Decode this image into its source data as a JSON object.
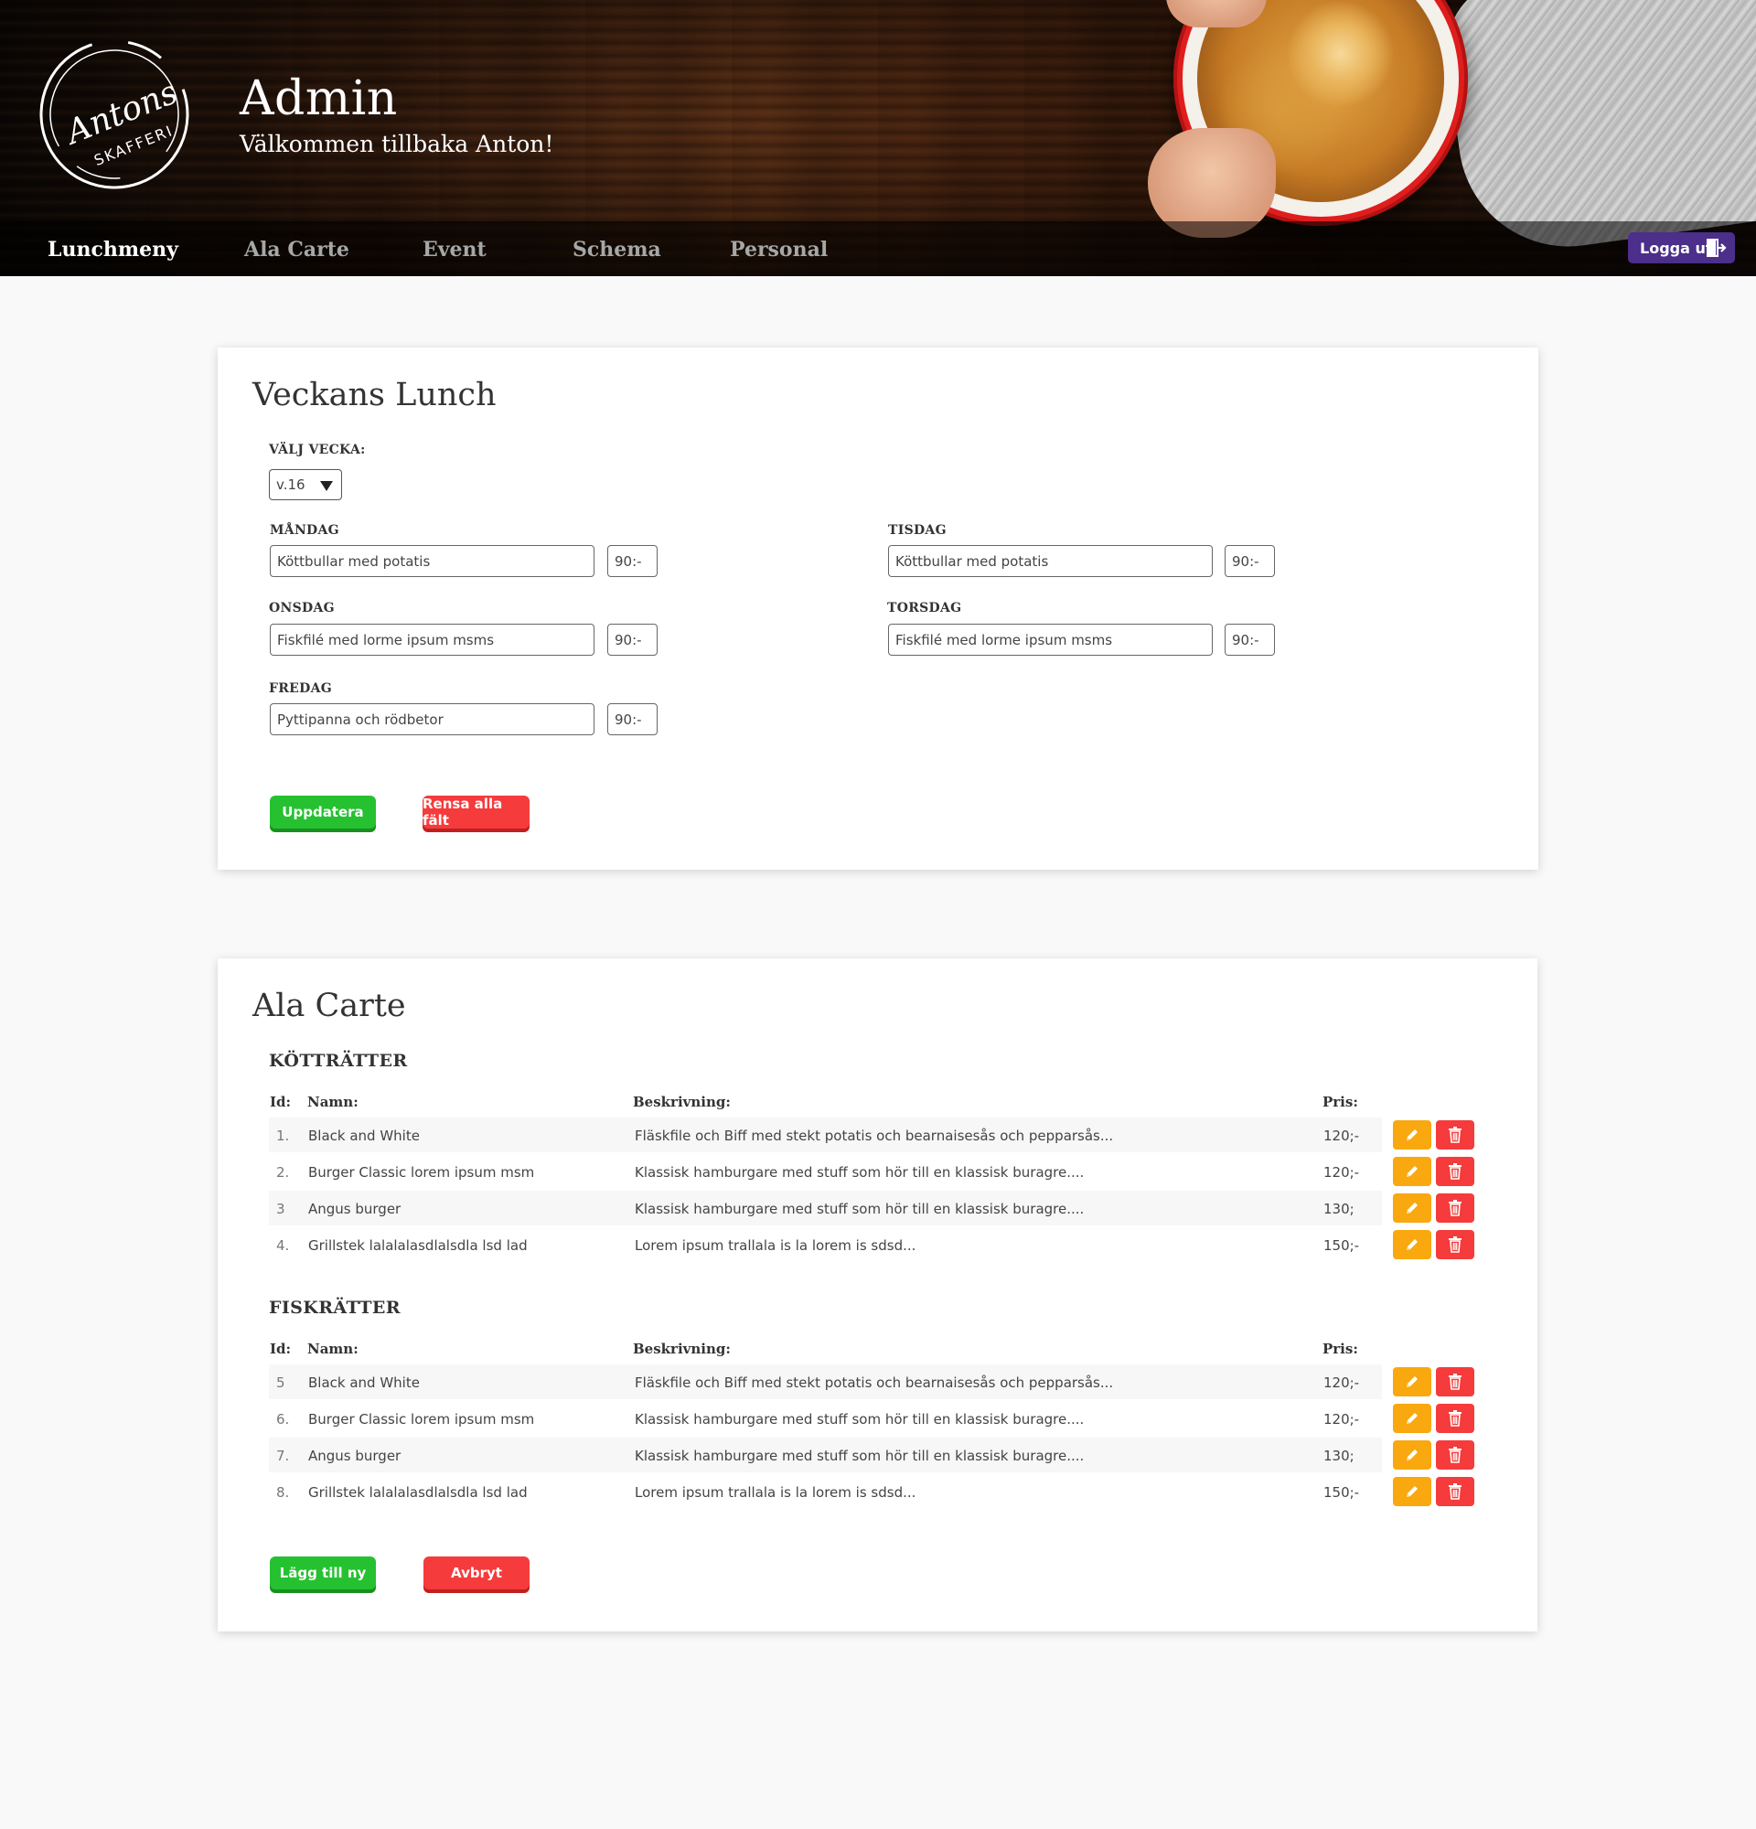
{
  "header": {
    "logo_text_script": "Antons",
    "logo_text_caps": "SKAFFERI",
    "title": "Admin",
    "welcome": "Välkommen tillbaka Anton!"
  },
  "nav": {
    "items": [
      {
        "label": "Lunchmeny",
        "active": true
      },
      {
        "label": "Ala Carte",
        "active": false
      },
      {
        "label": "Event",
        "active": false
      },
      {
        "label": "Schema",
        "active": false
      },
      {
        "label": "Personal",
        "active": false
      }
    ],
    "logout_label": "Logga ut"
  },
  "lunch": {
    "title": "Veckans Lunch",
    "week_label": "VÄLJ VECKA:",
    "week_value": "v.16",
    "days": [
      {
        "label": "MÅNDAG",
        "dish": "Köttbullar med potatis",
        "price": "90:-"
      },
      {
        "label": "TISDAG",
        "dish": "Köttbullar med potatis",
        "price": "90:-"
      },
      {
        "label": "ONSDAG",
        "dish": "Fiskfilé med lorme ipsum msms",
        "price": "90:-"
      },
      {
        "label": "TORSDAG",
        "dish": "Fiskfilé med lorme ipsum msms",
        "price": "90:-"
      },
      {
        "label": "FREDAG",
        "dish": "Pyttipanna och rödbetor",
        "price": "90:-"
      }
    ],
    "update_label": "Uppdatera",
    "clear_label": "Rensa alla fält"
  },
  "alacarte": {
    "title": "Ala Carte",
    "headers": {
      "id": "Id:",
      "name": "Namn:",
      "description": "Beskrivning:",
      "price": "Pris:"
    },
    "sections": [
      {
        "title": "KÖTTRÄTTER",
        "rows": [
          {
            "id": "1.",
            "name": "Black and White",
            "description": "Fläskfile och Biff med stekt potatis och bearnaisesås och pepparsås...",
            "price": "120;-"
          },
          {
            "id": "2.",
            "name": "Burger Classic lorem ipsum msm",
            "description": "Klassisk hamburgare med stuff som hör till en klassisk buragre....",
            "price": "120;-"
          },
          {
            "id": "3",
            "name": "Angus burger",
            "description": "Klassisk hamburgare med stuff som hör till en klassisk buragre....",
            "price": "130;"
          },
          {
            "id": "4.",
            "name": "Grillstek lalalalasdlalsdla lsd lad",
            "description": "Lorem ipsum trallala is la lorem is sdsd...",
            "price": "150;-"
          }
        ]
      },
      {
        "title": "FISKRÄTTER",
        "rows": [
          {
            "id": "5",
            "name": "Black and White",
            "description": "Fläskfile och Biff med stekt potatis och bearnaisesås och pepparsås...",
            "price": "120;-"
          },
          {
            "id": "6.",
            "name": "Burger Classic lorem ipsum msm",
            "description": "Klassisk hamburgare med stuff som hör till en klassisk buragre....",
            "price": "120;-"
          },
          {
            "id": "7.",
            "name": "Angus burger",
            "description": "Klassisk hamburgare med stuff som hör till en klassisk buragre....",
            "price": "130;"
          },
          {
            "id": "8.",
            "name": "Grillstek lalalalasdlalsdla lsd lad",
            "description": "Lorem ipsum trallala is la lorem is sdsd...",
            "price": "150;-"
          }
        ]
      }
    ],
    "add_label": "Lägg till ny",
    "cancel_label": "Avbryt"
  },
  "colors": {
    "green": "#26c131",
    "red": "#f53b3b",
    "orange": "#f9a80f",
    "purple": "#4b2f8a"
  },
  "icons": [
    "pencil-icon",
    "trash-icon",
    "logout-door-icon",
    "chevron-down-icon"
  ]
}
